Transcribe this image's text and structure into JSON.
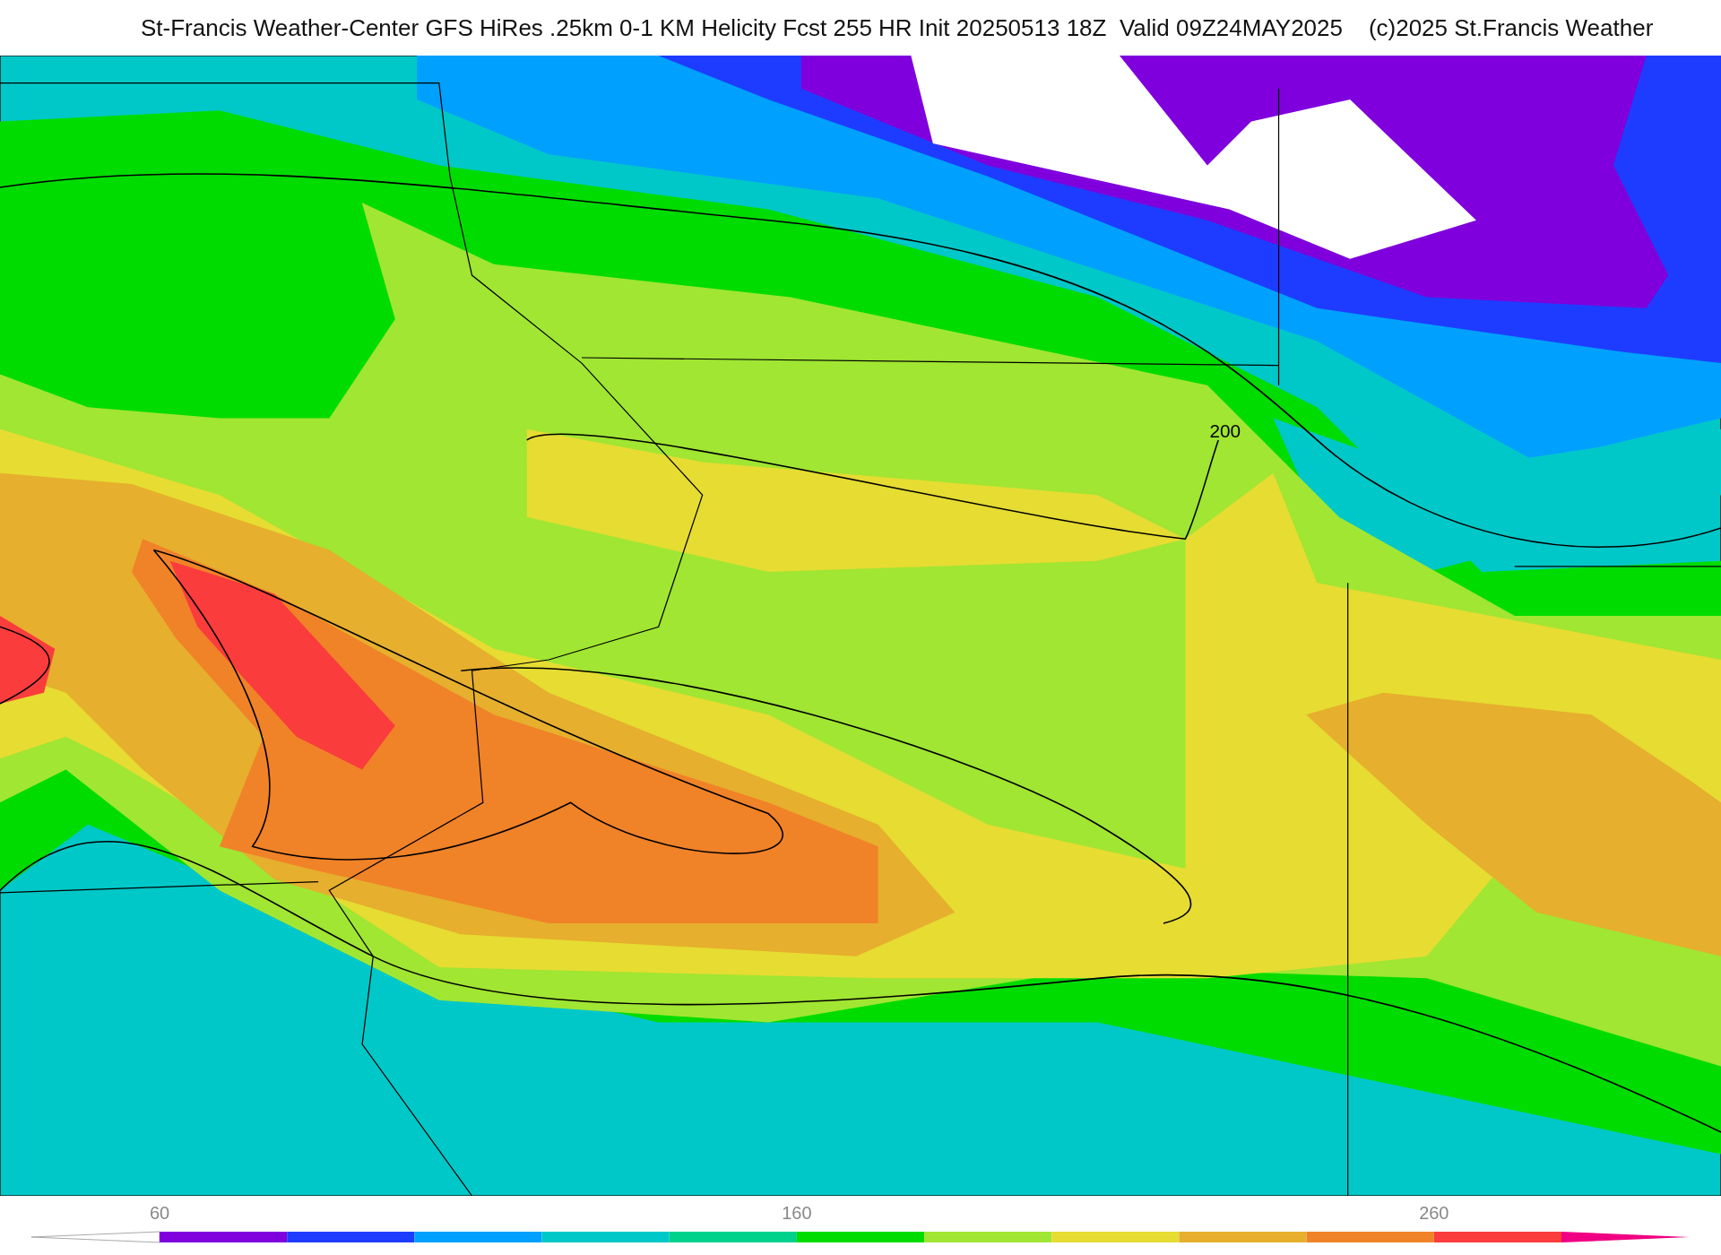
{
  "title": "St-Francis Weather-Center GFS HiRes .25km 0-1 KM Helicity Fcst 255 HR Init 20250513 18Z  Valid 09Z24MAY2025    (c)2025 St.Francis Weather",
  "map": {
    "contour_label": "200"
  },
  "colorbar": {
    "ticks": [
      "60",
      "160",
      "260"
    ],
    "segments": [
      {
        "color": "#7f00dd"
      },
      {
        "color": "#1e3cff"
      },
      {
        "color": "#00a0ff"
      },
      {
        "color": "#00c8c8"
      },
      {
        "color": "#00d28c"
      },
      {
        "color": "#00dc00"
      },
      {
        "color": "#a0e632"
      },
      {
        "color": "#e6dc32"
      },
      {
        "color": "#e6af2d"
      },
      {
        "color": "#f08228"
      },
      {
        "color": "#fa3c3c"
      }
    ],
    "ends": [
      {
        "color": "#ffffff"
      },
      {
        "color": "#f00082"
      }
    ]
  }
}
